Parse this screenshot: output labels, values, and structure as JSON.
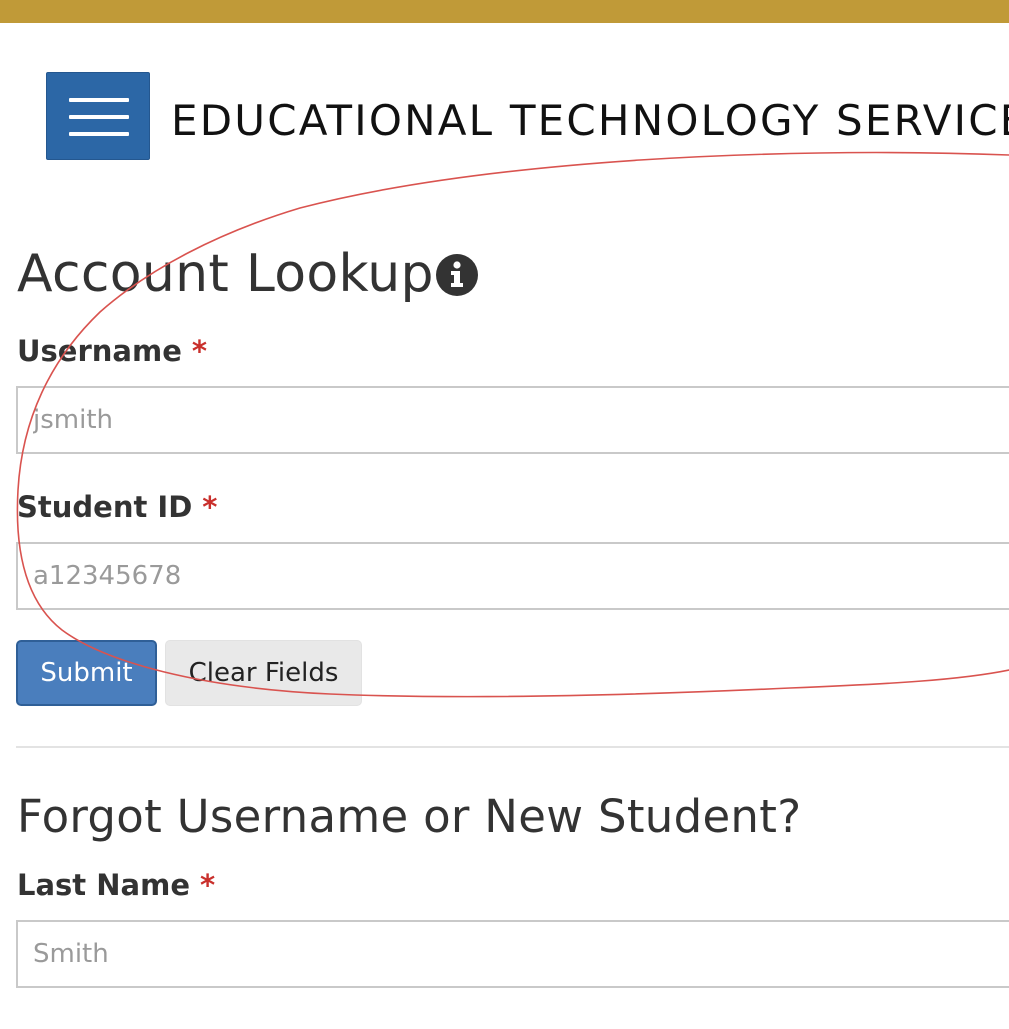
{
  "header": {
    "menu_icon": "hamburger-menu-icon",
    "site_title": "EDUCATIONAL TECHNOLOGY SERVICES",
    "accent_color": "#c09a38",
    "brand_color": "#2c67a6"
  },
  "account_lookup": {
    "title": "Account Lookup",
    "info_icon": "info-circle-icon",
    "username": {
      "label": "Username",
      "required_marker": "*",
      "placeholder": "jsmith",
      "value": ""
    },
    "student_id": {
      "label": "Student ID",
      "required_marker": "*",
      "placeholder": "a12345678",
      "value": ""
    },
    "submit_label": "Submit",
    "clear_label": "Clear Fields"
  },
  "forgot_username": {
    "title": "Forgot Username or New Student?",
    "last_name": {
      "label": "Last Name",
      "required_marker": "*",
      "placeholder": "Smith",
      "value": ""
    }
  },
  "annotation": {
    "color": "#d9534f"
  }
}
